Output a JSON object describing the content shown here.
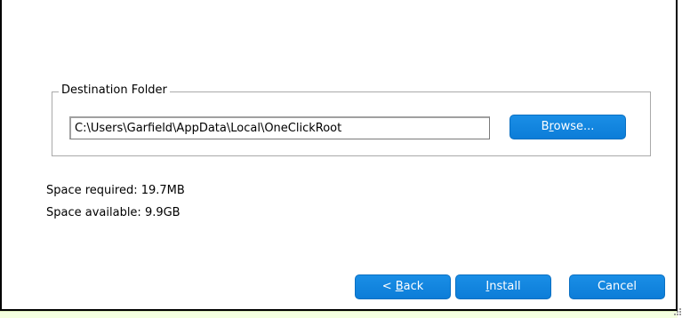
{
  "dialog": {
    "group_label": "Destination Folder",
    "path_value": "C:\\Users\\Garfield\\AppData\\Local\\OneClickRoot",
    "browse": {
      "pre": "B",
      "accel": "r",
      "post": "owse..."
    },
    "space_required": "Space required: 19.7MB",
    "space_available": "Space available: 9.9GB"
  },
  "buttons": {
    "back": {
      "pre": "< ",
      "accel": "B",
      "post": "ack"
    },
    "install": {
      "pre": "",
      "accel": "I",
      "post": "nstall"
    },
    "cancel": "Cancel"
  },
  "colors": {
    "button_blue": "#0c7dd8",
    "group_border": "#a9a9a9",
    "bottom_strip": "#f4ffe0"
  }
}
